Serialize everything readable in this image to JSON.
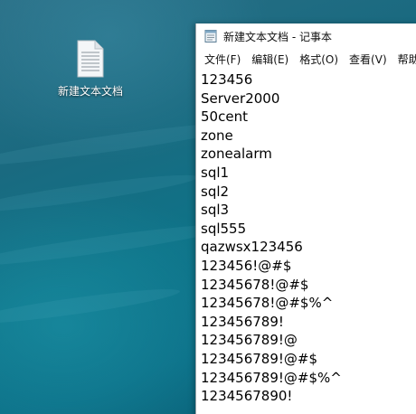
{
  "desktop": {
    "icon_label": "新建文本文档"
  },
  "notepad": {
    "title": "新建文本文档 - 记事本",
    "menu": [
      {
        "label": "文件(F)"
      },
      {
        "label": "编辑(E)"
      },
      {
        "label": "格式(O)"
      },
      {
        "label": "查看(V)"
      },
      {
        "label": "帮助"
      }
    ],
    "lines": [
      "123456",
      "Server2000",
      "50cent",
      "zone",
      "zonealarm",
      "sql1",
      "sql2",
      "sql3",
      "sql555",
      "qazwsx123456",
      "123456!@#$",
      "12345678!@#$",
      "12345678!@#$%^",
      "123456789!",
      "123456789!@",
      "123456789!@#$",
      "123456789!@#$%^",
      "1234567890!"
    ]
  },
  "icons": {
    "desktop_file": "text-file-icon",
    "app": "notepad-icon"
  }
}
